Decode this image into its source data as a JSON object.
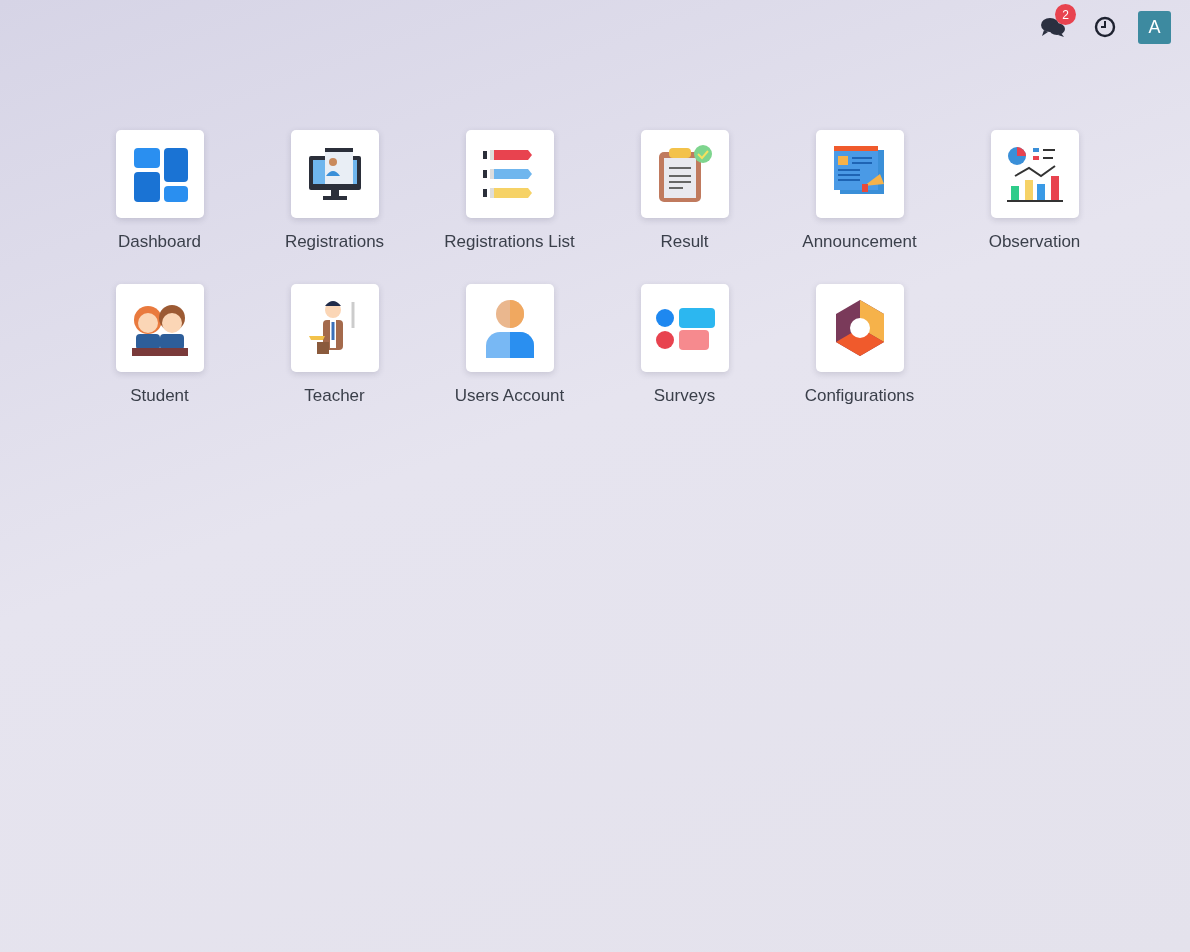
{
  "top_bar": {
    "messages_badge": "2",
    "avatar_letter": "A"
  },
  "apps": [
    {
      "label": "Dashboard",
      "kind": "dashboard"
    },
    {
      "label": "Registrations",
      "kind": "registrations"
    },
    {
      "label": "Registrations List",
      "kind": "list"
    },
    {
      "label": "Result",
      "kind": "result"
    },
    {
      "label": "Announcement",
      "kind": "announcement"
    },
    {
      "label": "Observation",
      "kind": "observation"
    },
    {
      "label": "Student",
      "kind": "student"
    },
    {
      "label": "Teacher",
      "kind": "teacher"
    },
    {
      "label": "Users Account",
      "kind": "users"
    },
    {
      "label": "Surveys",
      "kind": "surveys"
    },
    {
      "label": "Configurations",
      "kind": "configurations"
    }
  ]
}
